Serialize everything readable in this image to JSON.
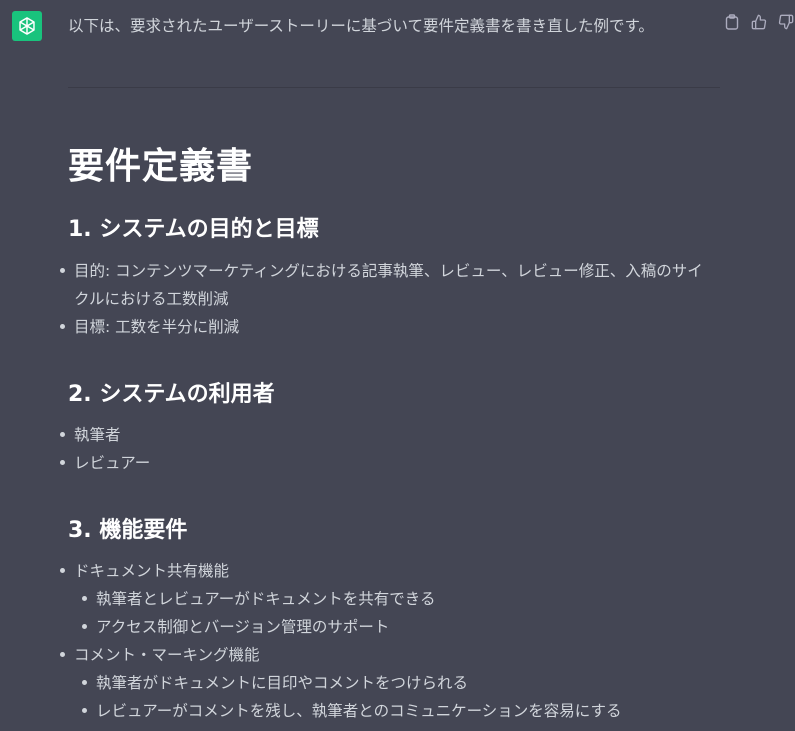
{
  "message": {
    "intro": "以下は、要求されたユーザーストーリーに基づいて要件定義書を書き直した例です。"
  },
  "actions": [
    "copy-icon",
    "thumbs-up-icon",
    "thumbs-down-icon"
  ],
  "doc": {
    "title": "要件定義書",
    "sections": [
      {
        "title": "1. システムの目的と目標",
        "items": [
          "目的: コンテンツマーケティングにおける記事執筆、レビュー、レビュー修正、入稿のサイ",
          "クルにおける工数削減",
          "目標: 工数を半分に削減"
        ]
      },
      {
        "title": "2. システムの利用者",
        "items": [
          "執筆者",
          "レビュアー"
        ]
      },
      {
        "title": "3. 機能要件",
        "items": [
          "ドキュメント共有機能",
          "執筆者とレビュアーがドキュメントを共有できる",
          "アクセス制御とバージョン管理のサポート",
          "コメント・マーキング機能",
          "執筆者がドキュメントに目印やコメントをつけられる",
          "レビュアーがコメントを残し、執筆者とのコミュニケーションを容易にする"
        ]
      }
    ]
  },
  "colors": {
    "background": "#444654",
    "avatar": "#19c37d",
    "text": "#d1d5db",
    "heading": "#ffffff"
  }
}
